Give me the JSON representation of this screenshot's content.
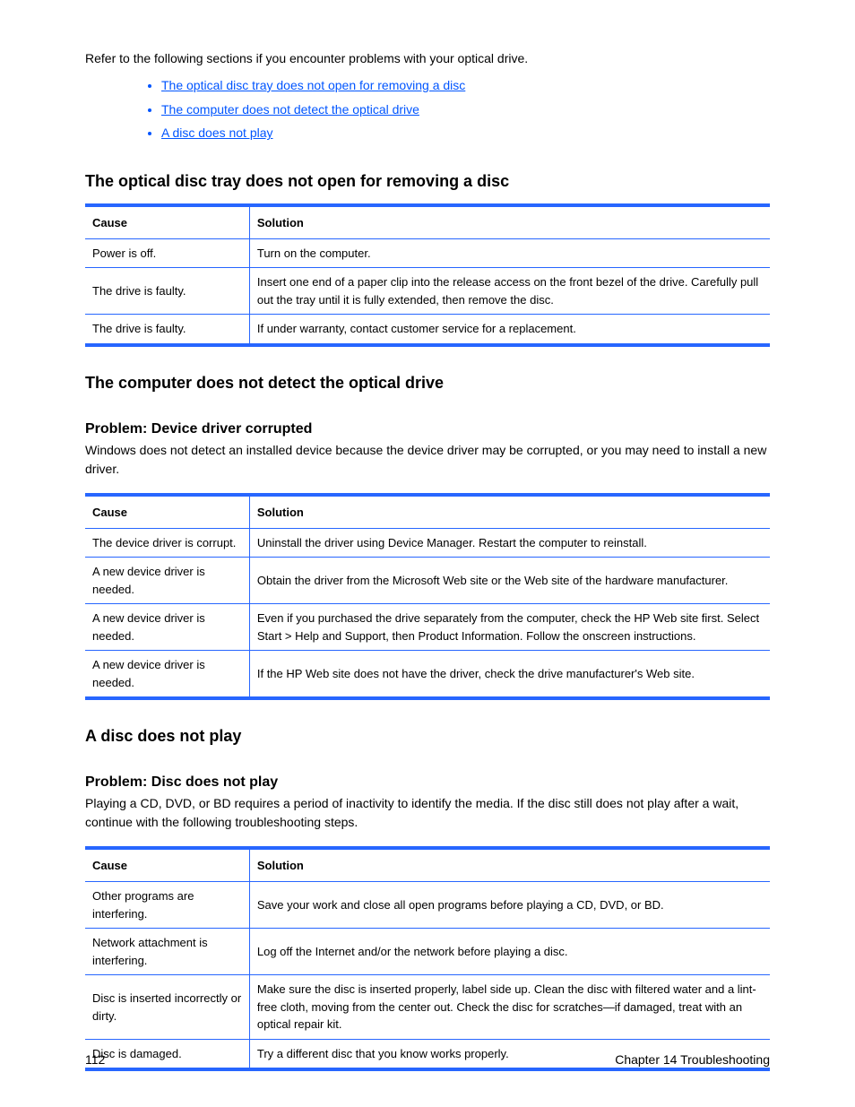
{
  "intro": "Refer to the following sections if you encounter problems with your optical drive.",
  "links": [
    "The optical disc tray does not open for removing a disc",
    "The computer does not detect the optical drive",
    "A disc does not play"
  ],
  "sections": [
    {
      "title": "The optical disc tray does not open for removing a disc",
      "table_headers": [
        "Cause",
        "Solution"
      ],
      "rows": [
        [
          "Power is off.",
          "Turn on the computer."
        ],
        [
          "The drive is faulty.",
          "Insert one end of a paper clip into the release access on the front bezel of the drive. Carefully pull out the tray until it is fully extended, then remove the disc."
        ],
        [
          "The drive is faulty.",
          "If under warranty, contact customer service for a replacement."
        ]
      ]
    },
    {
      "title": "The computer does not detect the optical drive",
      "problem": "Problem: Device driver corrupted",
      "desc": "Windows does not detect an installed device because the device driver may be corrupted, or you may need to install a new driver.",
      "table_headers": [
        "Cause",
        "Solution"
      ],
      "rows": [
        [
          "The device driver is corrupt.",
          "Uninstall the driver using Device Manager. Restart the computer to reinstall."
        ],
        [
          "A new device driver is needed.",
          "Obtain the driver from the Microsoft Web site or the Web site of the hardware manufacturer."
        ],
        [
          "A new device driver is needed.",
          "Even if you purchased the drive separately from the computer, check the HP Web site first. Select Start > Help and Support, then Product Information. Follow the onscreen instructions."
        ],
        [
          "A new device driver is needed.",
          "If the HP Web site does not have the driver, check the drive manufacturer's Web site."
        ]
      ]
    },
    {
      "title": "A disc does not play",
      "problem": "Problem: Disc does not play",
      "desc": "Playing a CD, DVD, or BD requires a period of inactivity to identify the media. If the disc still does not play after a wait, continue with the following troubleshooting steps.",
      "table_headers": [
        "Cause",
        "Solution"
      ],
      "rows": [
        [
          "Other programs are interfering.",
          "Save your work and close all open programs before playing a CD, DVD, or BD."
        ],
        [
          "Network attachment is interfering.",
          "Log off the Internet and/or the network before playing a disc."
        ],
        [
          "Disc is inserted incorrectly or dirty.",
          "Make sure the disc is inserted properly, label side up. Clean the disc with filtered water and a lint-free cloth, moving from the center out. Check the disc for scratches—if damaged, treat with an optical repair kit."
        ],
        [
          "Disc is damaged.",
          "Try a different disc that you know works properly."
        ]
      ]
    }
  ],
  "footer": {
    "left": "112",
    "right": "Chapter 14   Troubleshooting"
  }
}
